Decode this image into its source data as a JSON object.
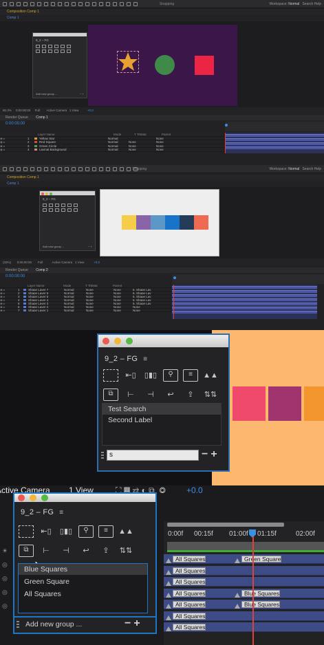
{
  "app": {
    "workspace_label": "Workspace:",
    "workspace_value": "Normal",
    "search_help": "Search Help",
    "snapping": "Snapping"
  },
  "panel1": {
    "comp_header_prefix": "Composition",
    "comp_name": "Comp 1",
    "tab": "Comp 1",
    "fg_title": "9_2 – FG",
    "fg_footer": "Add new group ...",
    "zoom": "60.3%",
    "timecode_status": "0:00:00:00",
    "resolution": "Full",
    "camera": "Active Camera",
    "view": "1 View",
    "exposure": "+0.0",
    "render_queue": "Render Queue",
    "comp_tab": "Comp 1",
    "timecode": "0:00:00:00",
    "col_layer_name": "Layer Name",
    "col_mode": "Mode",
    "col_trkmat": "T TrkMat",
    "col_parent": "Parent",
    "layers": [
      {
        "num": "1",
        "name": "Yellow Star",
        "mode": "Normal",
        "trk": "",
        "parent": "None",
        "color": "#d4a22a"
      },
      {
        "num": "2",
        "name": "Red Square",
        "mode": "Normal",
        "trk": "None",
        "parent": "None",
        "color": "#d44"
      },
      {
        "num": "3",
        "name": "Green Circle",
        "mode": "Normal",
        "trk": "None",
        "parent": "None",
        "color": "#4a4"
      },
      {
        "num": "4",
        "name": "Lavinal Background",
        "mode": "Normal",
        "trk": "None",
        "parent": "None",
        "color": "#c88"
      }
    ],
    "canvas_color": "#3a1748",
    "shape_colors": {
      "star": "#e8a030",
      "circle": "#3f8a48",
      "square": "#ec2545"
    }
  },
  "panel2": {
    "comp_header_prefix": "Composition",
    "comp_name": "Comp 1",
    "tab": "Comp 1",
    "fg_title": "9_2 – FG",
    "fg_footer": "Add new group ...",
    "zoom": "(33%)",
    "timecode_status": "0:00:00:00",
    "resolution": "Full",
    "camera": "Active Camera",
    "view": "1 View",
    "exposure": "+0.0",
    "render_queue": "Render Queue",
    "comp_tab": "Comp 2",
    "timecode": "0:00:00:00",
    "col_layer_name": "Layer Name",
    "col_mode": "Mode",
    "col_trkmat": "T TrkMat",
    "col_parent": "Parent",
    "layers": [
      {
        "num": "1",
        "name": "Shape Layer 7",
        "mode": "Normal",
        "trk": "None",
        "parent": "None",
        "pnode": "6. Shape Lay"
      },
      {
        "num": "2",
        "name": "Shape Layer 6",
        "mode": "Normal",
        "trk": "None",
        "parent": "None",
        "pnode": "6. Shape Lay"
      },
      {
        "num": "3",
        "name": "Shape Layer 5",
        "mode": "Normal",
        "trk": "None",
        "parent": "None",
        "pnode": "6. Shape Lay"
      },
      {
        "num": "4",
        "name": "Shape Layer 4",
        "mode": "Normal",
        "trk": "None",
        "parent": "None",
        "pnode": "6. Shape Lay"
      },
      {
        "num": "5",
        "name": "Shape Layer 3",
        "mode": "Normal",
        "trk": "None",
        "parent": "None",
        "pnode": "6. Shape Lay"
      },
      {
        "num": "6",
        "name": "Shape Layer 2",
        "mode": "Normal",
        "trk": "None",
        "parent": "None",
        "pnode": "None"
      },
      {
        "num": "7",
        "name": "Shape Layer 1",
        "mode": "Normal",
        "trk": "None",
        "parent": "None",
        "pnode": "None"
      }
    ],
    "swatches": [
      "#f6cd49",
      "#8a64a8",
      "#5b98c8",
      "#1874c8",
      "#253c58",
      "#ef6a52"
    ]
  },
  "panel3": {
    "fg_title": "9_2 – FG",
    "groups": [
      "Test Search",
      "Second Label"
    ],
    "search_value": "s",
    "minus": "−",
    "plus": "+",
    "bg_color": "#fbb86e",
    "squares": [
      "#ef4a6c",
      "#a0346e",
      "#f3962e"
    ]
  },
  "panel4": {
    "camera": "Active Camera",
    "view": "1 View",
    "exposure": "+0.0",
    "fg_title": "9_2 – FG",
    "groups": [
      "Blue Squares",
      "Green Square",
      "All Squares"
    ],
    "footer": "Add new group ...",
    "minus": "−",
    "plus": "+",
    "ruler_labels": [
      "0:00f",
      "00:15f",
      "01:00f",
      "01:15f",
      "02:00f"
    ],
    "clips": [
      {
        "label": "All Squares"
      },
      {
        "label": "Green Square"
      },
      {
        "label": "All Squares"
      },
      {
        "label": "All Squares"
      },
      {
        "label": "All Squares"
      },
      {
        "label": "Blue Squares"
      },
      {
        "label": "All Squares"
      },
      {
        "label": "Blue Squares"
      },
      {
        "label": "All Squares"
      },
      {
        "label": "All Squares"
      }
    ]
  },
  "icons": [
    "select-bounds-icon",
    "align-left-arrow-icon",
    "distribute-icon",
    "anchor-icon",
    "text-lines-icon",
    "mountains-icon",
    "precompose-icon",
    "align-left-icon",
    "align-right-icon",
    "link-icon",
    "new-layer-icon",
    "sort-arrows-icon"
  ],
  "colors": {
    "accent": "#1d77c7",
    "playhead": "#e0413a",
    "timecode": "#3d8fe0",
    "track": "#3d4b86"
  }
}
